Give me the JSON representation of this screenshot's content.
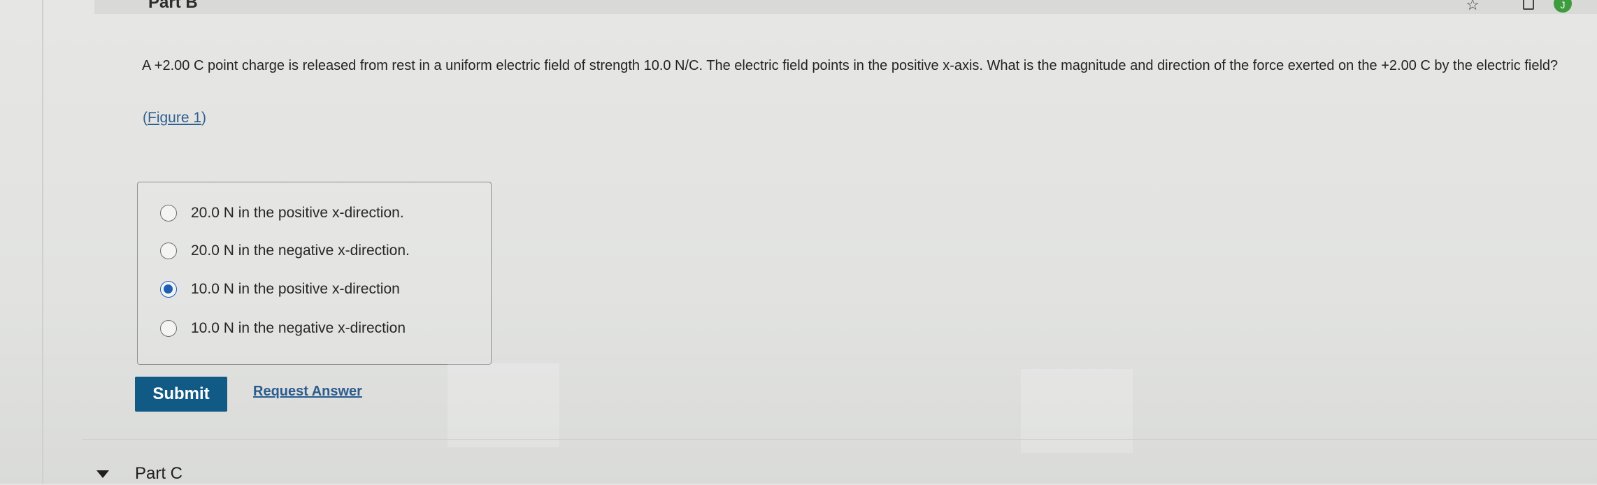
{
  "partB": {
    "title": "Part B"
  },
  "question": {
    "text": "A +2.00 C point charge is released from rest in a uniform electric field of strength 10.0 N/C. The electric field points in the positive x-axis. What is the magnitude and direction of the force exerted on the +2.00 C by the electric field?",
    "figure_link_open": "(",
    "figure_link_text": "Figure 1",
    "figure_link_close": ")"
  },
  "options": [
    {
      "label": "20.0 N in the positive x-direction.",
      "selected": false
    },
    {
      "label": "20.0 N in the negative x-direction.",
      "selected": false
    },
    {
      "label": "10.0 N in the positive x-direction",
      "selected": true
    },
    {
      "label": "10.0 N in the negative x-direction",
      "selected": false
    }
  ],
  "actions": {
    "submit_label": "Submit",
    "request_answer_label": "Request Answer"
  },
  "partC": {
    "title": "Part C"
  },
  "toolbar": {
    "user_initial": "J"
  },
  "colors": {
    "accent": "#125a86",
    "radio_selected": "#1e5fb5",
    "link": "#2a5c8e"
  }
}
